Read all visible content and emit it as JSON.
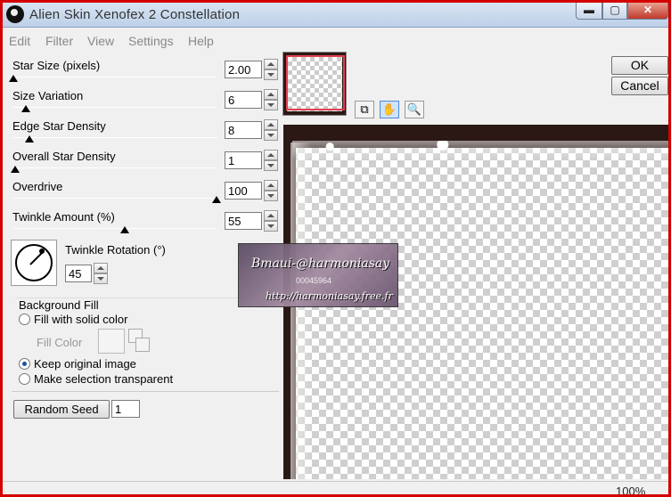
{
  "window": {
    "title": "Alien Skin Xenofex 2 Constellation",
    "min_glyph": "▬",
    "max_glyph": "▢",
    "close_glyph": "✕"
  },
  "menu": [
    "Edit",
    "Filter",
    "View",
    "Settings",
    "Help"
  ],
  "params": [
    {
      "label": "Star Size (pixels)",
      "value": "2.00",
      "level": 0.0
    },
    {
      "label": "Size Variation",
      "value": "6",
      "level": 0.06
    },
    {
      "label": "Edge Star Density",
      "value": "8",
      "level": 0.08
    },
    {
      "label": "Overall Star Density",
      "value": "1",
      "level": 0.01
    },
    {
      "label": "Overdrive",
      "value": "100",
      "level": 1.0
    },
    {
      "label": "Twinkle Amount (%)",
      "value": "55",
      "level": 0.55
    }
  ],
  "twinkle": {
    "label": "Twinkle Rotation (°)",
    "value": "45"
  },
  "background_fill": {
    "title": "Background Fill",
    "solid_label": "Fill with solid color",
    "fill_color_label": "Fill Color",
    "keep_label": "Keep original image",
    "transparent_label": "Make selection transparent",
    "selected": "keep"
  },
  "random_seed": {
    "label": "Random Seed",
    "value": "1"
  },
  "buttons": {
    "ok": "OK",
    "cancel": "Cancel"
  },
  "tools": {
    "preview_toggle_icon": "preview-compare-icon",
    "hand_icon": "hand-icon",
    "zoom_icon": "magnifier-icon",
    "hand_glyph": "✋",
    "zoom_glyph": "🔍",
    "compare_glyph": "⧉"
  },
  "watermark": {
    "line1": "Bmaui-@harmoniasay",
    "line2": "00045964",
    "line3": "http://harmoniasay.free.fr"
  },
  "status": {
    "zoom": "100%"
  },
  "colors": {
    "frame": "#d40000",
    "border_dark": "#2b1814"
  }
}
